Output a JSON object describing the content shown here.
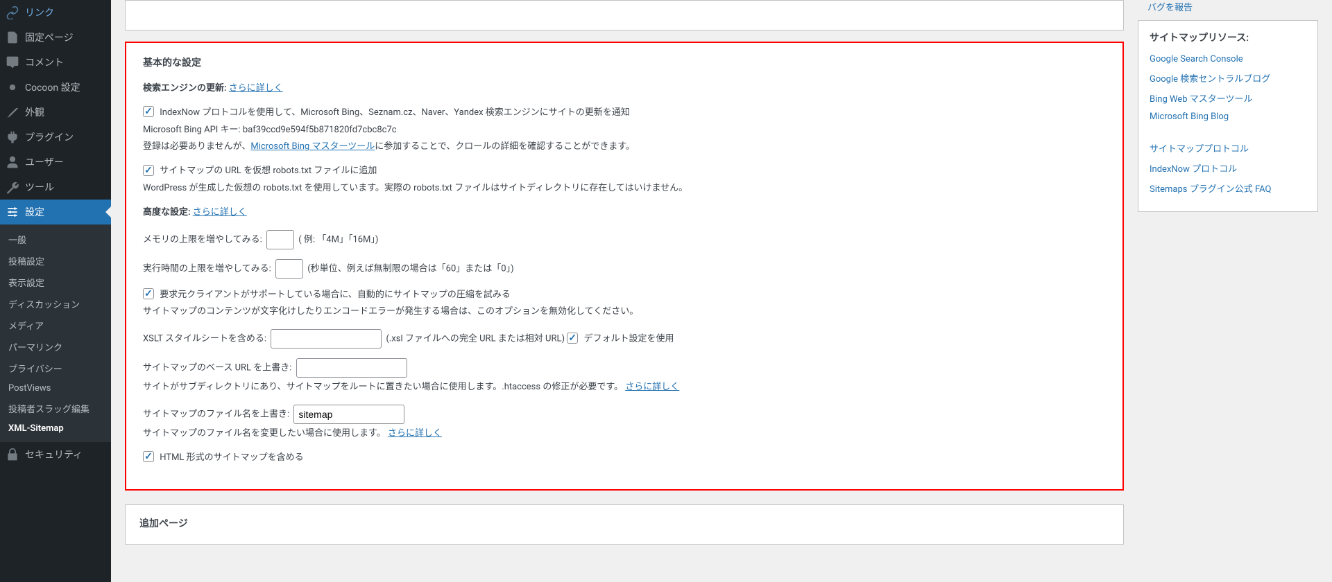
{
  "sidebar": {
    "items": [
      {
        "label": "リンク"
      },
      {
        "label": "固定ページ"
      },
      {
        "label": "コメント"
      },
      {
        "label": "Cocoon 設定"
      },
      {
        "label": "外観"
      },
      {
        "label": "プラグイン"
      },
      {
        "label": "ユーザー"
      },
      {
        "label": "ツール"
      },
      {
        "label": "設定",
        "current": true
      },
      {
        "label": "セキュリティ"
      }
    ],
    "submenu": [
      {
        "label": "一般"
      },
      {
        "label": "投稿設定"
      },
      {
        "label": "表示設定"
      },
      {
        "label": "ディスカッション"
      },
      {
        "label": "メディア"
      },
      {
        "label": "パーマリンク"
      },
      {
        "label": "プライバシー"
      },
      {
        "label": "PostViews"
      },
      {
        "label": "投稿者スラッグ編集"
      },
      {
        "label": "XML-Sitemap",
        "current": true
      }
    ]
  },
  "main": {
    "basic_title": "基本的な設定",
    "search_engine_label": "検索エンジンの更新:",
    "learn_more": "さらに詳しく",
    "indexnow_label": "IndexNow プロトコルを使用して、Microsoft Bing、Seznam.cz、Naver、Yandex 検索エンジンにサイトの更新を通知",
    "bing_api_key": "Microsoft Bing API キー: baf39ccd9e594f5b871820fd7cbc8c7c",
    "bing_reg_pre": "登録は必要ありませんが、",
    "bing_master_link": "Microsoft Bing マスターツール",
    "bing_reg_post": "に参加することで、クロールの詳細を確認することができます。",
    "robots_label": "サイトマップの URL を仮想 robots.txt ファイルに追加",
    "robots_desc": "WordPress が生成した仮想の robots.txt を使用しています。実際の robots.txt ファイルはサイトディレクトリに存在してはいけません。",
    "advanced_label": "高度な設定:",
    "memory_label": "メモリの上限を増やしてみる:",
    "memory_hint": "( 例: 「4M」「16M」)",
    "exec_label": "実行時間の上限を増やしてみる:",
    "exec_hint": "(秒単位、例えば無制限の場合は「60」または「0」)",
    "compress_label": "要求元クライアントがサポートしている場合に、自動的にサイトマップの圧縮を試みる",
    "compress_desc": "サイトマップのコンテンツが文字化けしたりエンコードエラーが発生する場合は、このオプションを無効化してください。",
    "xslt_label": "XSLT スタイルシートを含める:",
    "xslt_hint": "(.xsl ファイルへの完全 URL または相対 URL)",
    "xslt_default_label": "デフォルト設定を使用",
    "baseurl_label": "サイトマップのベース URL を上書き:",
    "baseurl_desc_pre": "サイトがサブディレクトリにあり、サイトマップをルートに置きたい場合に使用します。.htaccess の修正が必要です。",
    "filename_label": "サイトマップのファイル名を上書き:",
    "filename_value": "sitemap",
    "filename_desc_pre": "サイトマップのファイル名を変更したい場合に使用します。",
    "html_sitemap_label": "HTML 形式のサイトマップを含める",
    "additional_title": "追加ページ"
  },
  "right": {
    "bug_report": "バグを報告",
    "resources_title": "サイトマップリソース:",
    "links1": [
      "Google Search Console",
      "Google 検索セントラルブログ",
      "Bing Web マスターツール",
      "Microsoft Bing Blog"
    ],
    "links2": [
      "サイトマッププロトコル",
      "IndexNow プロトコル",
      "Sitemaps プラグイン公式 FAQ"
    ]
  }
}
